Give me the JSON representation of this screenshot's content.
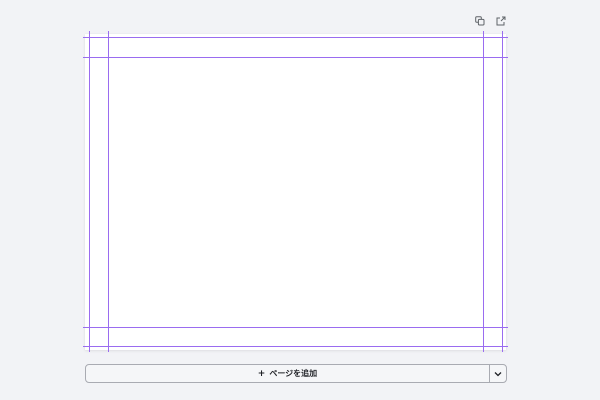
{
  "toolbar": {
    "duplicate_icon": "duplicate-icon",
    "share_icon": "share-icon"
  },
  "add_page": {
    "plus": "+",
    "label": "ページを追加",
    "dropdown_icon": "chevron-down-icon"
  },
  "colors": {
    "background": "#f2f3f6",
    "page": "#ffffff",
    "guide": "#9a6cf0",
    "button_border": "#a9abb2"
  }
}
